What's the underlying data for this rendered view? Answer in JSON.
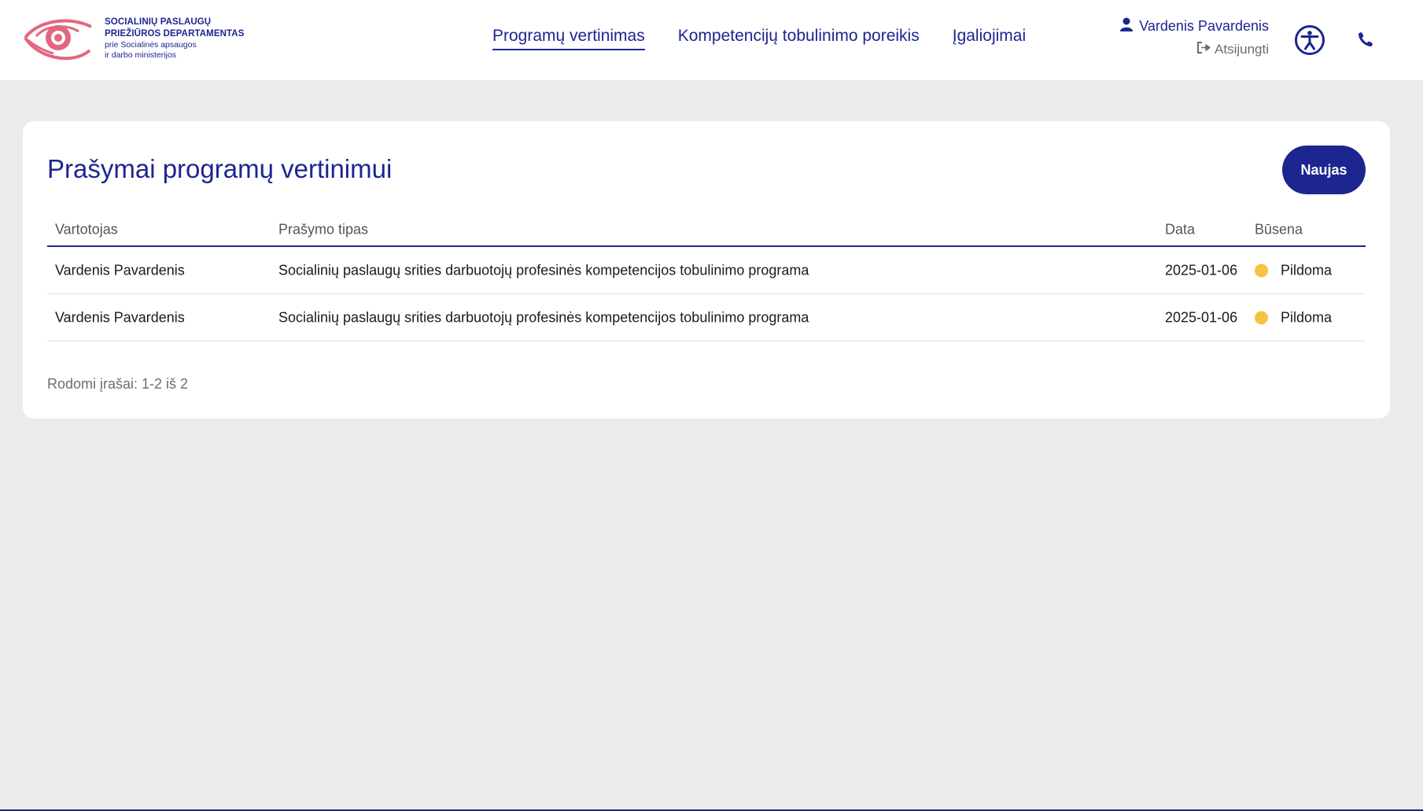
{
  "colors": {
    "brand": "#1d2590",
    "logo_accent": "#e2677f",
    "status_filling": "#f5c340",
    "background": "#ebebeb"
  },
  "logo": {
    "line1": "SOCIALINIŲ PASLAUGŲ",
    "line2": "PRIEŽIŪROS DEPARTAMENTAS",
    "line3": "prie Socialinės apsaugos",
    "line4": "ir darbo ministerijos",
    "icon": "eye-logo-icon"
  },
  "nav": {
    "items": [
      {
        "label": "Programų vertinimas",
        "active": true
      },
      {
        "label": "Kompetencijų tobulinimo poreikis",
        "active": false
      },
      {
        "label": "Įgaliojimai",
        "active": false
      }
    ]
  },
  "user": {
    "name": "Vardenis Pavardenis",
    "logout": "Atsijungti",
    "icons": [
      "user-icon",
      "sign-out-icon",
      "accessibility-icon",
      "phone-icon"
    ]
  },
  "main": {
    "title": "Prašymai programų vertinimui",
    "new_button": "Naujas",
    "table": {
      "columns": [
        "Vartotojas",
        "Prašymo tipas",
        "Data",
        "Būsena"
      ],
      "rows": [
        {
          "user": "Vardenis Pavardenis",
          "type": "Socialinių paslaugų srities darbuotojų profesinės kompetencijos tobulinimo programa",
          "date": "2025-01-06",
          "status": "Pildoma"
        },
        {
          "user": "Vardenis Pavardenis",
          "type": "Socialinių paslaugų srities darbuotojų profesinės kompetencijos tobulinimo programa",
          "date": "2025-01-06",
          "status": "Pildoma"
        }
      ]
    },
    "records_text": "Rodomi įrašai: 1-2 iš 2"
  }
}
